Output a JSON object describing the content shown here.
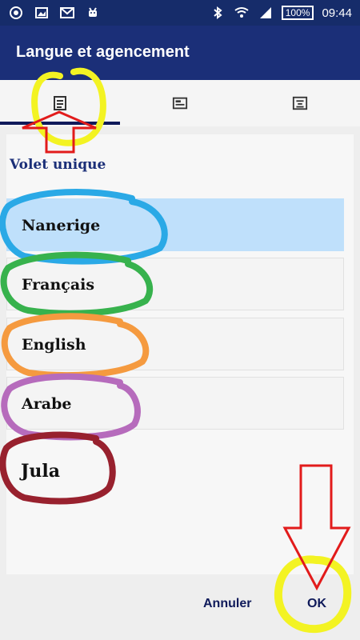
{
  "status_bar": {
    "left_icons": [
      "android-circle-icon",
      "image-icon",
      "gmail-icon",
      "android-robot-icon"
    ],
    "battery": "100%",
    "time": "09:44"
  },
  "app_bar": {
    "title": "Langue et agencement"
  },
  "tabs": [
    {
      "icon": "single-pane-icon"
    },
    {
      "icon": "list-pane-icon"
    },
    {
      "icon": "text-align-icon"
    }
  ],
  "section": {
    "title": "Volet unique"
  },
  "languages": [
    {
      "label": "Nanerige",
      "selected": true
    },
    {
      "label": "Français",
      "selected": false
    },
    {
      "label": "English",
      "selected": false
    },
    {
      "label": "Arabe",
      "selected": false
    },
    {
      "label": "Jula",
      "selected": false
    }
  ],
  "buttons": {
    "cancel": "Annuler",
    "ok": "OK"
  },
  "colors": {
    "status_bar": "#162c6a",
    "app_bar": "#1b2f78",
    "selected_item": "#bfe0fb",
    "annot_yellow": "#f3f323",
    "annot_blue": "#2aa9e6",
    "annot_green": "#37b24d",
    "annot_orange": "#f59a3f",
    "annot_purple": "#b66bbc",
    "annot_darkred": "#98212e",
    "annot_red_arrow": "#e21b1b"
  }
}
